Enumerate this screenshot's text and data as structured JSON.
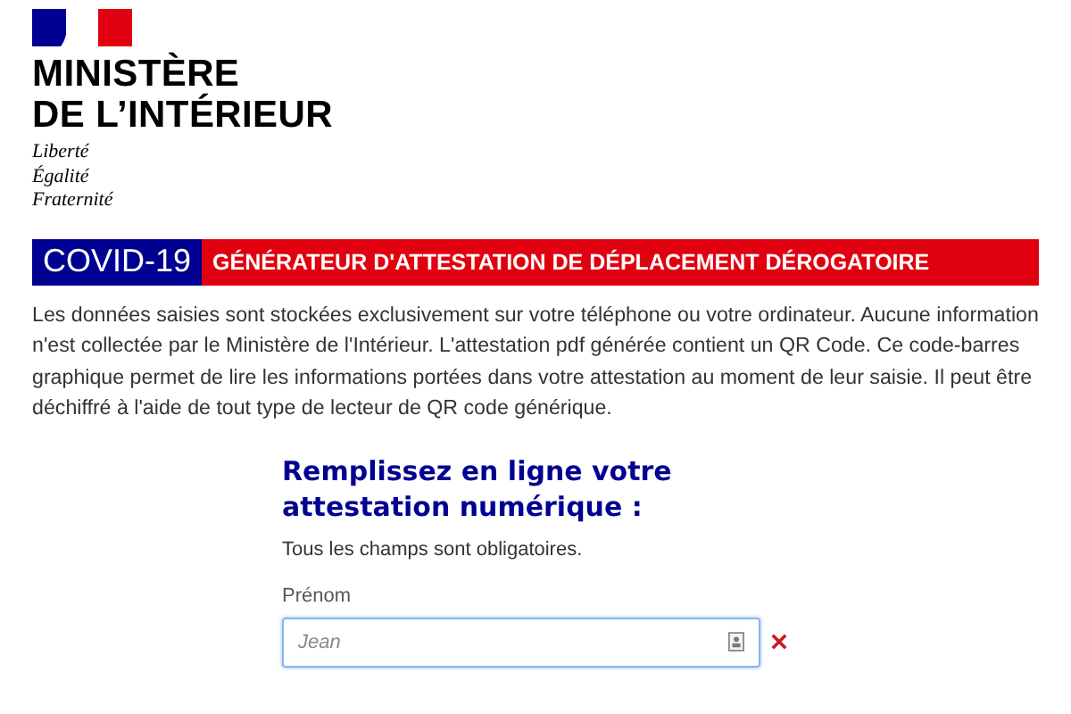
{
  "header": {
    "ministry_lines": [
      "MINISTÈRE",
      "DE L’INTÉRIEUR"
    ],
    "motto": [
      "Liberté",
      "Égalité",
      "Fraternité"
    ]
  },
  "banner": {
    "tag": "COVID-19",
    "title": "GÉNÉRATEUR D'ATTESTATION DE DÉPLACEMENT DÉROGATOIRE"
  },
  "intro": "Les données saisies sont stockées exclusivement sur votre téléphone ou votre ordinateur. Aucune information n'est collectée par le Ministère de l'Intérieur. L'attestation pdf générée contient un QR Code. Ce code-barres graphique permet de lire les informations portées dans votre attestation au moment de leur saisie. Il peut être déchiffré à l'aide de tout type de lecteur de QR code générique.",
  "form": {
    "heading": "Remplissez en ligne votre attestation numérique :",
    "note": "Tous les champs sont obligatoires.",
    "fields": [
      {
        "label": "Prénom",
        "placeholder": "Jean",
        "invalid": true
      }
    ]
  }
}
